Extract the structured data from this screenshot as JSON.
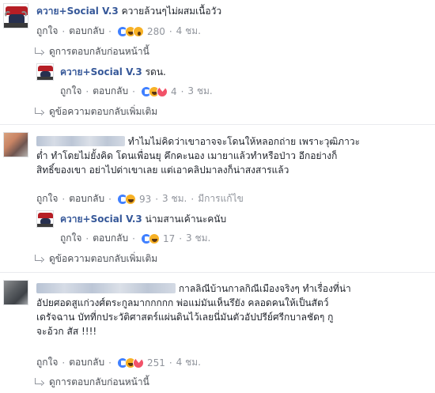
{
  "labels": {
    "like": "ถูกใจ",
    "reply": "ตอบกลับ",
    "dot": "·",
    "view_previous_replies": "ดูการตอบกลับก่อนหน้านี้",
    "view_more_replies": "ดูข้อความตอบกลับเพิ่มเติม",
    "edited": "มีการแก้ไข"
  },
  "brand": {
    "name": "ควาย+Social V.3"
  },
  "comment1": {
    "text": "ควายล้วนๆไม่ผสมเนื้อวัว",
    "reactions": [
      "like-icon",
      "haha-icon",
      "wow-icon"
    ],
    "reaction_count": "280",
    "time": "4 ชม."
  },
  "reply1": {
    "text": "รดน.",
    "reactions": [
      "like-icon",
      "haha-icon",
      "love-icon"
    ],
    "reaction_count": "4",
    "time": "3 ชม."
  },
  "comment2": {
    "lines": [
      "ทำไมไม่คิดว่าเขาอาจจะโดนให้หลอกถ่าย เพราะวุฒิภาวะ",
      "ต่ำ ทำโดยไม่ยั้งคิด โดนเพื่อนยุ คึกคะนอง เมายาแล้วทำหรือป่าว อีกอย่างก็",
      "สิทธิ์ของเขา อย่าไปด่าเขาเลย แต่เอาคลิปมาลงก็น่าสงสารแล้ว"
    ],
    "reactions": [
      "like-icon",
      "haha-icon"
    ],
    "reaction_count": "93",
    "time": "3 ชม."
  },
  "reply2": {
    "text": "น่ามสานเค้านะคนับ",
    "reactions": [
      "like-icon",
      "haha-icon"
    ],
    "reaction_count": "17",
    "time": "3 ชม."
  },
  "comment3": {
    "lines": [
      "กาลลิณีบ้านกาลกิณีเมืองจริงๆ ทำเรื่องที่น่า",
      "อัปยศอดสูแก่วงศ์ตระกูลมากกกกก พ่อแม่มันเห็นรึยัง คลอดคนให้เป็นสัตว์",
      "เดรัจฉาน บัทที่กประวัติศาสตร์แผ่นดินไว้เลยนี่มันตัวอัปปรีย์ศรีกบาลชัดๆ กู",
      "จะอ้วก สัส !!!!"
    ],
    "reactions": [
      "like-icon",
      "haha-icon",
      "love-icon"
    ],
    "reaction_count": "251",
    "time": "4 ชม."
  },
  "colors": {
    "link_blue": "#365899",
    "meta_gray": "#90949c",
    "action_gray": "#4b4f56"
  }
}
